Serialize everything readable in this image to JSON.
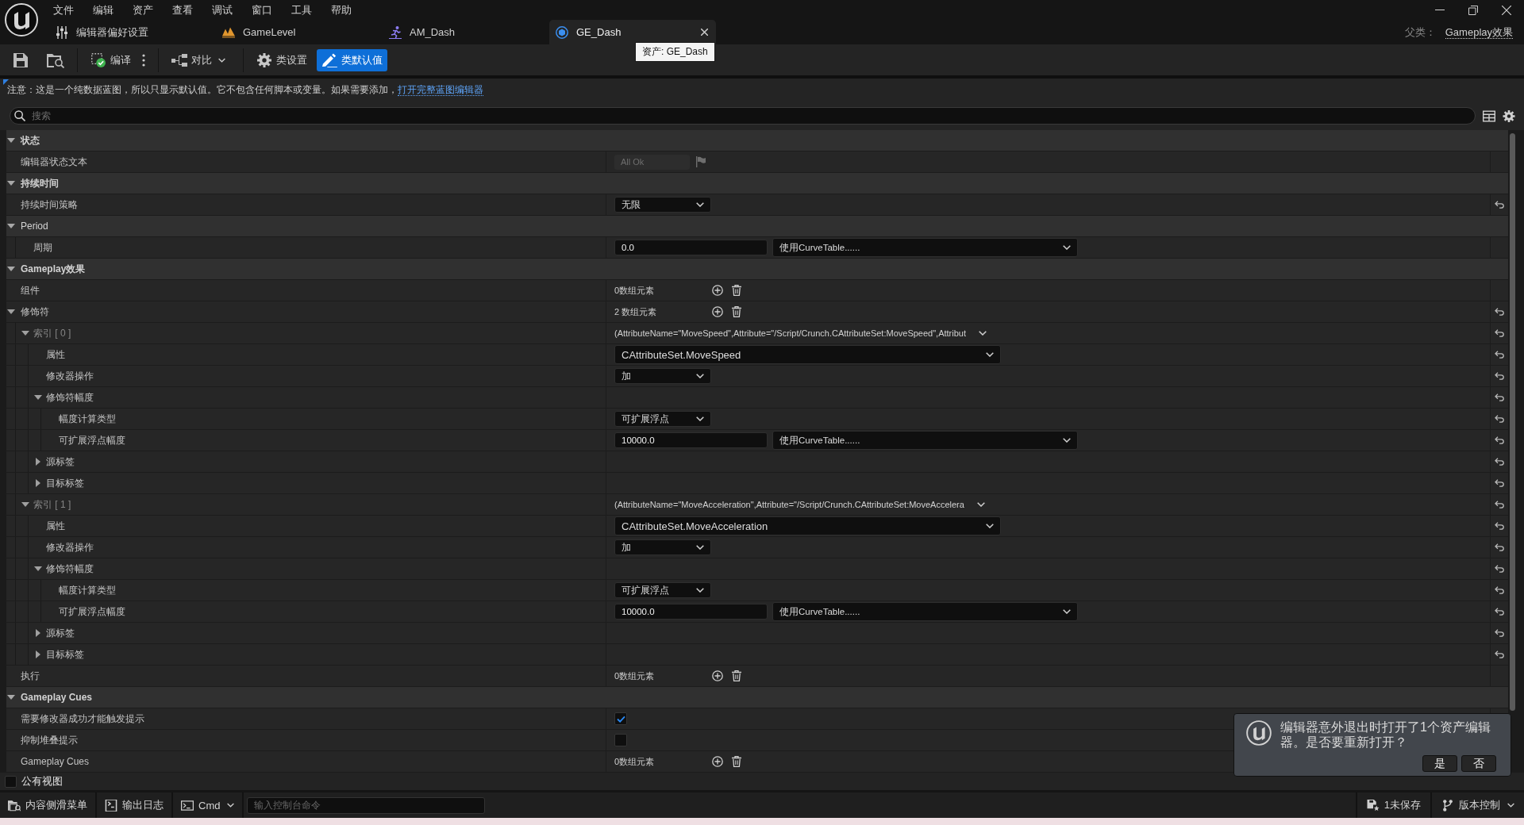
{
  "menu": [
    "文件",
    "编辑",
    "资产",
    "查看",
    "调试",
    "窗口",
    "工具",
    "帮助"
  ],
  "tabs": [
    {
      "label": "编辑器偏好设置",
      "kind": "settings",
      "selected": false
    },
    {
      "label": "GameLevel",
      "kind": "level",
      "selected": false
    },
    {
      "label": "AM_Dash",
      "kind": "montage",
      "selected": false
    },
    {
      "label": "GE_Dash",
      "kind": "blueprint",
      "selected": true
    }
  ],
  "tab_tooltip": "资产: GE_Dash",
  "parent_class": {
    "label": "父类：",
    "value": "Gameplay效果"
  },
  "toolbar": [
    {
      "kind": "compile",
      "label": "编译",
      "selected": false
    },
    {
      "kind": "diff",
      "label": "对比",
      "selected": false
    },
    {
      "kind": "class_settings",
      "label": "类设置",
      "selected": false
    },
    {
      "kind": "class_defaults",
      "label": "类默认值",
      "selected": true
    }
  ],
  "notice": {
    "text": "注意：这是一个纯数据蓝图，所以只显示默认值。它不包含任何脚本或变量。如果需要添加，",
    "link": "打开完整蓝图编辑器"
  },
  "search": {
    "placeholder": "搜索"
  },
  "sections": [
    {
      "label": "状态",
      "kind": "category",
      "expanded": true,
      "rows": [
        {
          "label": "编辑器状态文本",
          "reset": false,
          "value": {
            "kind": "status",
            "text": "All Ok"
          }
        }
      ]
    },
    {
      "label": "持续时间",
      "kind": "category",
      "expanded": true,
      "rows": [
        {
          "label": "持续时间策略",
          "reset": true,
          "value": {
            "kind": "enum",
            "text": "无限"
          }
        }
      ]
    },
    {
      "label": "Period",
      "kind": "struct",
      "expanded": true,
      "rows": [
        {
          "label": "周期",
          "reset": false,
          "value": {
            "kind": "curve",
            "number": "0.0",
            "table": "使用CurveTable......"
          }
        }
      ]
    },
    {
      "label": "Gameplay效果",
      "kind": "category",
      "expanded": true,
      "rows": [
        {
          "label": "组件",
          "reset": false,
          "value": {
            "kind": "array",
            "text": "0数组元素"
          }
        },
        {
          "label": "修饰符",
          "reset": true,
          "expanded": true,
          "value": {
            "kind": "array",
            "text": "2 数组元素"
          },
          "children": [
            {
              "label": "索引 [ 0 ]",
              "reset": true,
              "expanded": true,
              "value": {
                "kind": "struct",
                "text": "(AttributeName=\"MoveSpeed\",Attribute=\"/Script/Crunch.CAttributeSet:MoveSpeed\",Attribut"
              },
              "children": [
                {
                  "label": "属性",
                  "reset": true,
                  "value": {
                    "kind": "attribute",
                    "text": "CAttributeSet.MoveSpeed"
                  }
                },
                {
                  "label": "修改器操作",
                  "reset": true,
                  "value": {
                    "kind": "enum",
                    "text": "加"
                  }
                },
                {
                  "label": "修饰符幅度",
                  "reset": true,
                  "expanded": true,
                  "children": [
                    {
                      "label": "幅度计算类型",
                      "reset": true,
                      "value": {
                        "kind": "enum",
                        "text": "可扩展浮点"
                      }
                    },
                    {
                      "label": "可扩展浮点幅度",
                      "reset": true,
                      "value": {
                        "kind": "curve",
                        "number": "10000.0",
                        "table": "使用CurveTable......"
                      }
                    }
                  ]
                },
                {
                  "label": "源标签",
                  "reset": true,
                  "expanded": false
                },
                {
                  "label": "目标标签",
                  "reset": true,
                  "expanded": false
                }
              ]
            },
            {
              "label": "索引 [ 1 ]",
              "reset": true,
              "expanded": true,
              "value": {
                "kind": "struct",
                "text": "(AttributeName=\"MoveAcceleration\",Attribute=\"/Script/Crunch.CAttributeSet:MoveAccelera"
              },
              "children": [
                {
                  "label": "属性",
                  "reset": true,
                  "value": {
                    "kind": "attribute",
                    "text": "CAttributeSet.MoveAcceleration"
                  }
                },
                {
                  "label": "修改器操作",
                  "reset": true,
                  "value": {
                    "kind": "enum",
                    "text": "加"
                  }
                },
                {
                  "label": "修饰符幅度",
                  "reset": true,
                  "expanded": true,
                  "children": [
                    {
                      "label": "幅度计算类型",
                      "reset": true,
                      "value": {
                        "kind": "enum",
                        "text": "可扩展浮点"
                      }
                    },
                    {
                      "label": "可扩展浮点幅度",
                      "reset": true,
                      "value": {
                        "kind": "curve",
                        "number": "10000.0",
                        "table": "使用CurveTable......"
                      }
                    }
                  ]
                },
                {
                  "label": "源标签",
                  "reset": true,
                  "expanded": false
                },
                {
                  "label": "目标标签",
                  "reset": true,
                  "expanded": false
                }
              ]
            }
          ]
        },
        {
          "label": "执行",
          "reset": false,
          "value": {
            "kind": "array",
            "text": "0数组元素"
          }
        }
      ]
    },
    {
      "label": "Gameplay Cues",
      "kind": "category",
      "expanded": true,
      "rows": [
        {
          "label": "需要修改器成功才能触发提示",
          "reset": false,
          "value": {
            "kind": "checkbox",
            "checked": true
          }
        },
        {
          "label": "抑制堆叠提示",
          "reset": false,
          "value": {
            "kind": "checkbox",
            "checked": false
          }
        },
        {
          "label": "Gameplay Cues",
          "reset": false,
          "value": {
            "kind": "array",
            "text": "0数组元素"
          }
        }
      ]
    }
  ],
  "public_view": {
    "label": "公有视图",
    "checked": false
  },
  "status_bar": {
    "left": [
      {
        "kind": "drawer",
        "label": "内容侧滑菜单"
      },
      {
        "kind": "log",
        "label": "输出日志"
      }
    ],
    "console": {
      "label": "Cmd",
      "placeholder": "输入控制台命令"
    },
    "right": [
      {
        "kind": "unsaved",
        "label": "1未保存"
      },
      {
        "kind": "source_control",
        "label": "版本控制"
      }
    ]
  },
  "notification": {
    "message": "编辑器意外退出时打开了1个资产编辑器。是否要重新打开？",
    "buttons": [
      "是",
      "否"
    ]
  }
}
